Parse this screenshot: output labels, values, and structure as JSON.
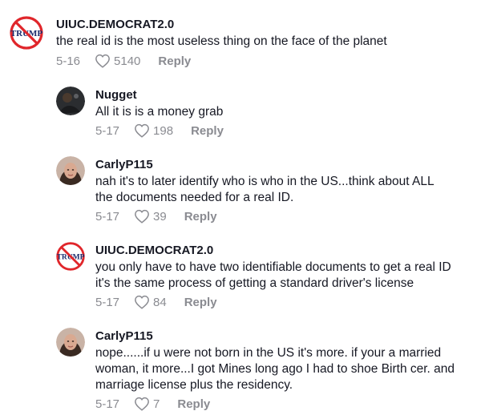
{
  "comments": [
    {
      "username": "UIUC.DEMOCRAT2.0",
      "avatar_icon": "no-trump-icon",
      "avatar_text": "TRUMP",
      "lines": [
        "the real id is the most useless thing on the face of the planet"
      ],
      "date": "5-16",
      "likes": "5140",
      "reply_label": "Reply"
    },
    {
      "username": "Nugget",
      "avatar_icon": "dark-photo-avatar",
      "lines": [
        "All it is is a money grab"
      ],
      "date": "5-17",
      "likes": "198",
      "reply_label": "Reply"
    },
    {
      "username": "CarlyP115",
      "avatar_icon": "selfie-avatar",
      "lines": [
        "nah it's to later identify who is who in the US...think about ALL",
        "the documents needed for a real ID."
      ],
      "date": "5-17",
      "likes": "39",
      "reply_label": "Reply"
    },
    {
      "username": "UIUC.DEMOCRAT2.0",
      "avatar_icon": "no-trump-icon",
      "avatar_text": "TRUMP",
      "lines": [
        "you only have to have two identifiable documents to get a real ID",
        "it's the same process of getting a standard driver's license"
      ],
      "date": "5-17",
      "likes": "84",
      "reply_label": "Reply"
    },
    {
      "username": "CarlyP115",
      "avatar_icon": "selfie-avatar",
      "lines": [
        "nope......if u were not born in the US it's more. if your a married",
        "woman, it more...I got Mines long ago I had to shoe Birth cer. and",
        "marriage license plus the residency."
      ],
      "date": "5-17",
      "likes": "7",
      "reply_label": "Reply"
    }
  ],
  "colors": {
    "text": "#161823",
    "meta": "#8a8b91",
    "no_sign_red": "#e0262b"
  }
}
